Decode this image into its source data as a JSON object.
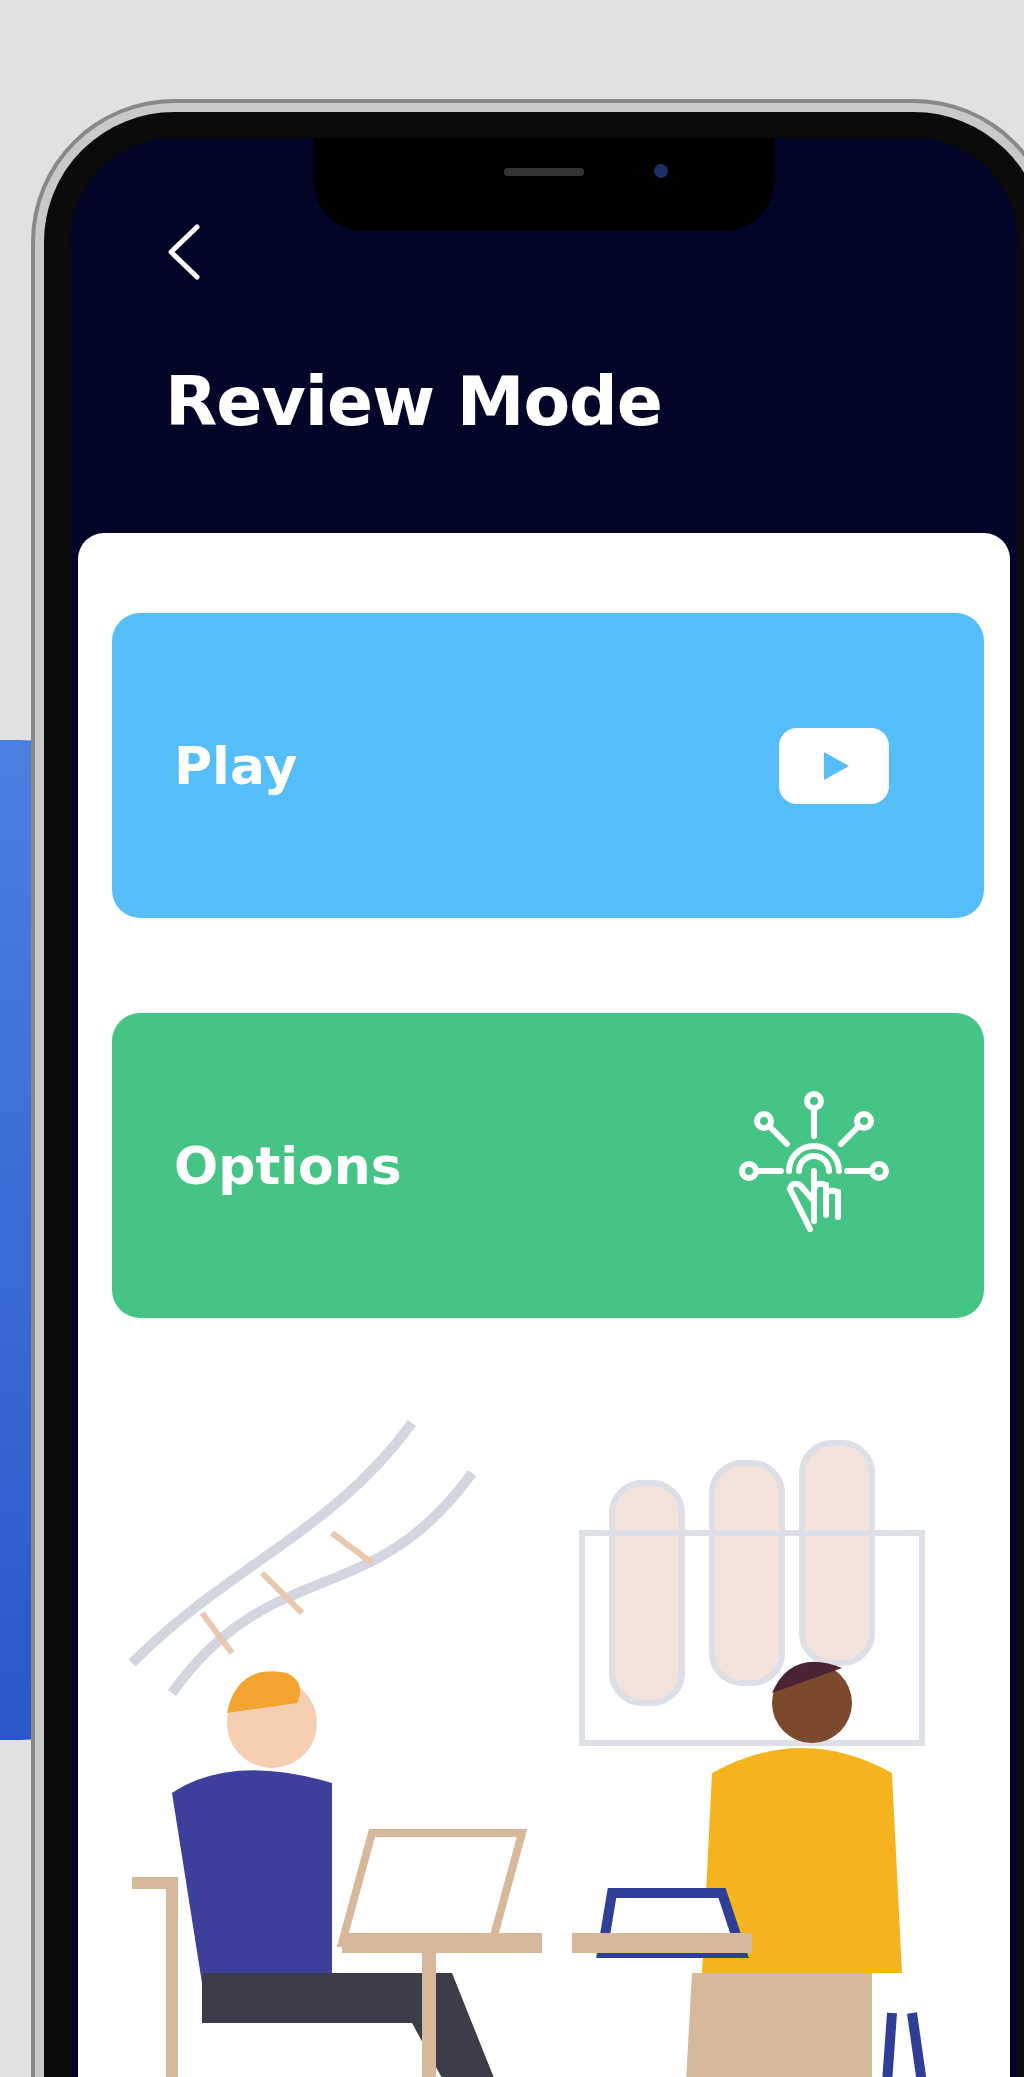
{
  "screen": {
    "title": "Review Mode"
  },
  "menu": [
    {
      "label": "Play",
      "kind": "play",
      "color": "#55bdf7"
    },
    {
      "label": "Options",
      "kind": "options",
      "color": "#45c486"
    }
  ]
}
